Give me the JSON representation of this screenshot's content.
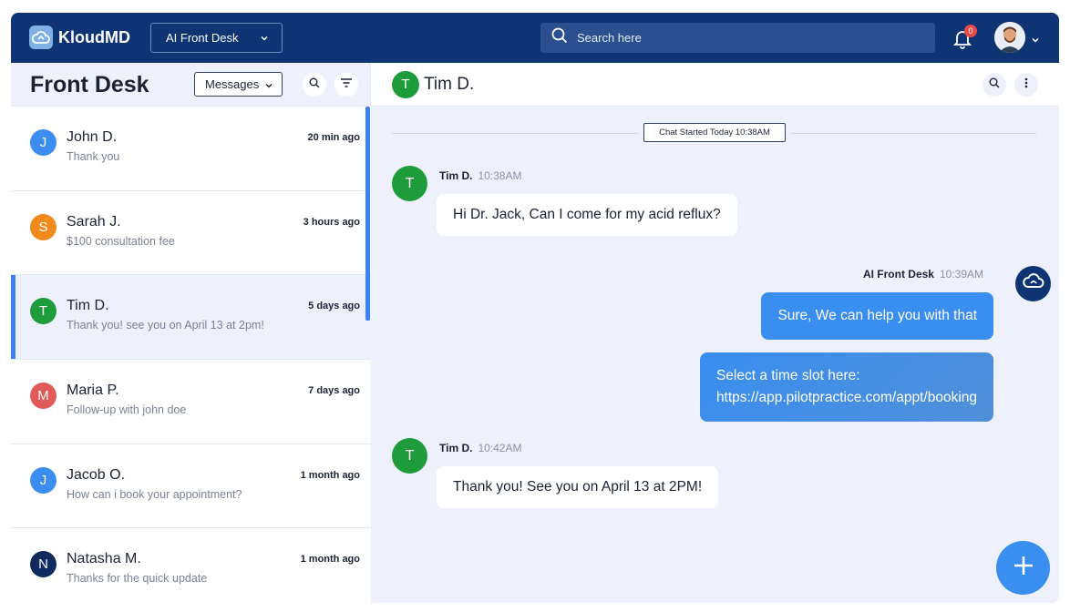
{
  "topbar": {
    "logo_text": "KloudMD",
    "agent_select": "AI Front Desk",
    "search_placeholder": "Search here",
    "notification_count": "0"
  },
  "left": {
    "title": "Front Desk",
    "filter_select": "Messages",
    "conversations": [
      {
        "initial": "J",
        "name": "John D.",
        "time": "20 min ago",
        "snippet": "Thank you",
        "color": "#3b8ef0"
      },
      {
        "initial": "S",
        "name": "Sarah J.",
        "time": "3 hours ago",
        "snippet": "$100 consultation fee",
        "color": "#f08a1c"
      },
      {
        "initial": "T",
        "name": "Tim D.",
        "time": "5 days ago",
        "snippet": "Thank you! see you on April 13 at 2pm!",
        "color": "#1e9b3a"
      },
      {
        "initial": "M",
        "name": "Maria P.",
        "time": "7 days ago",
        "snippet": "Follow-up with john doe",
        "color": "#e05a5a"
      },
      {
        "initial": "J",
        "name": "Jacob O.",
        "time": "1 month ago",
        "snippet": "How can i book your appointment?",
        "color": "#3b8ef0"
      },
      {
        "initial": "N",
        "name": "Natasha M.",
        "time": "1 month ago",
        "snippet": "Thanks for the quick update",
        "color": "#0f2a5c"
      }
    ]
  },
  "chat": {
    "contact_initial": "T",
    "contact_name": "Tim D.",
    "started_label": "Chat Started Today 10:38AM",
    "messages": [
      {
        "sender": "Tim D.",
        "time": "10:38AM",
        "text": "Hi Dr. Jack, Can I come for my acid reflux?"
      },
      {
        "sender": "AI Front Desk",
        "time": "10:39AM",
        "text": "Sure, We can help you with that"
      },
      {
        "sender": "AI Front Desk",
        "time": "",
        "text_line1": "Select a time slot here:",
        "text_line2": "https://app.pilotpractice.com/appt/booking"
      },
      {
        "sender": "Tim D.",
        "time": "10:42AM",
        "text": "Thank you! See you on April 13 at 2PM!"
      }
    ]
  },
  "colors": {
    "navy": "#0f3473",
    "accent": "#3a8ef0",
    "active_green": "#1e9b3a"
  }
}
